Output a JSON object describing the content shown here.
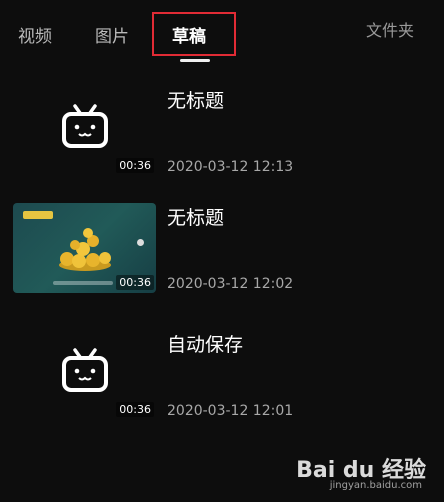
{
  "tabs": {
    "video": "视频",
    "image": "图片",
    "draft": "草稿",
    "folder": "文件夹"
  },
  "drafts": [
    {
      "title": "无标题",
      "date": "2020-03-12 12:13",
      "duration": "00:36",
      "thumb": "bilibili-tv-placeholder"
    },
    {
      "title": "无标题",
      "date": "2020-03-12 12:02",
      "duration": "00:36",
      "thumb": "gold-coins-cover"
    },
    {
      "title": "自动保存",
      "date": "2020-03-12 12:01",
      "duration": "00:36",
      "thumb": "bilibili-tv-placeholder"
    }
  ],
  "watermark": {
    "brand": "Bai du 经验",
    "url": "jingyan.baidu.com"
  },
  "colors": {
    "background": "#0d0d0d",
    "highlight_box": "#e12b35",
    "cover_teal": "#1d4a4f"
  }
}
